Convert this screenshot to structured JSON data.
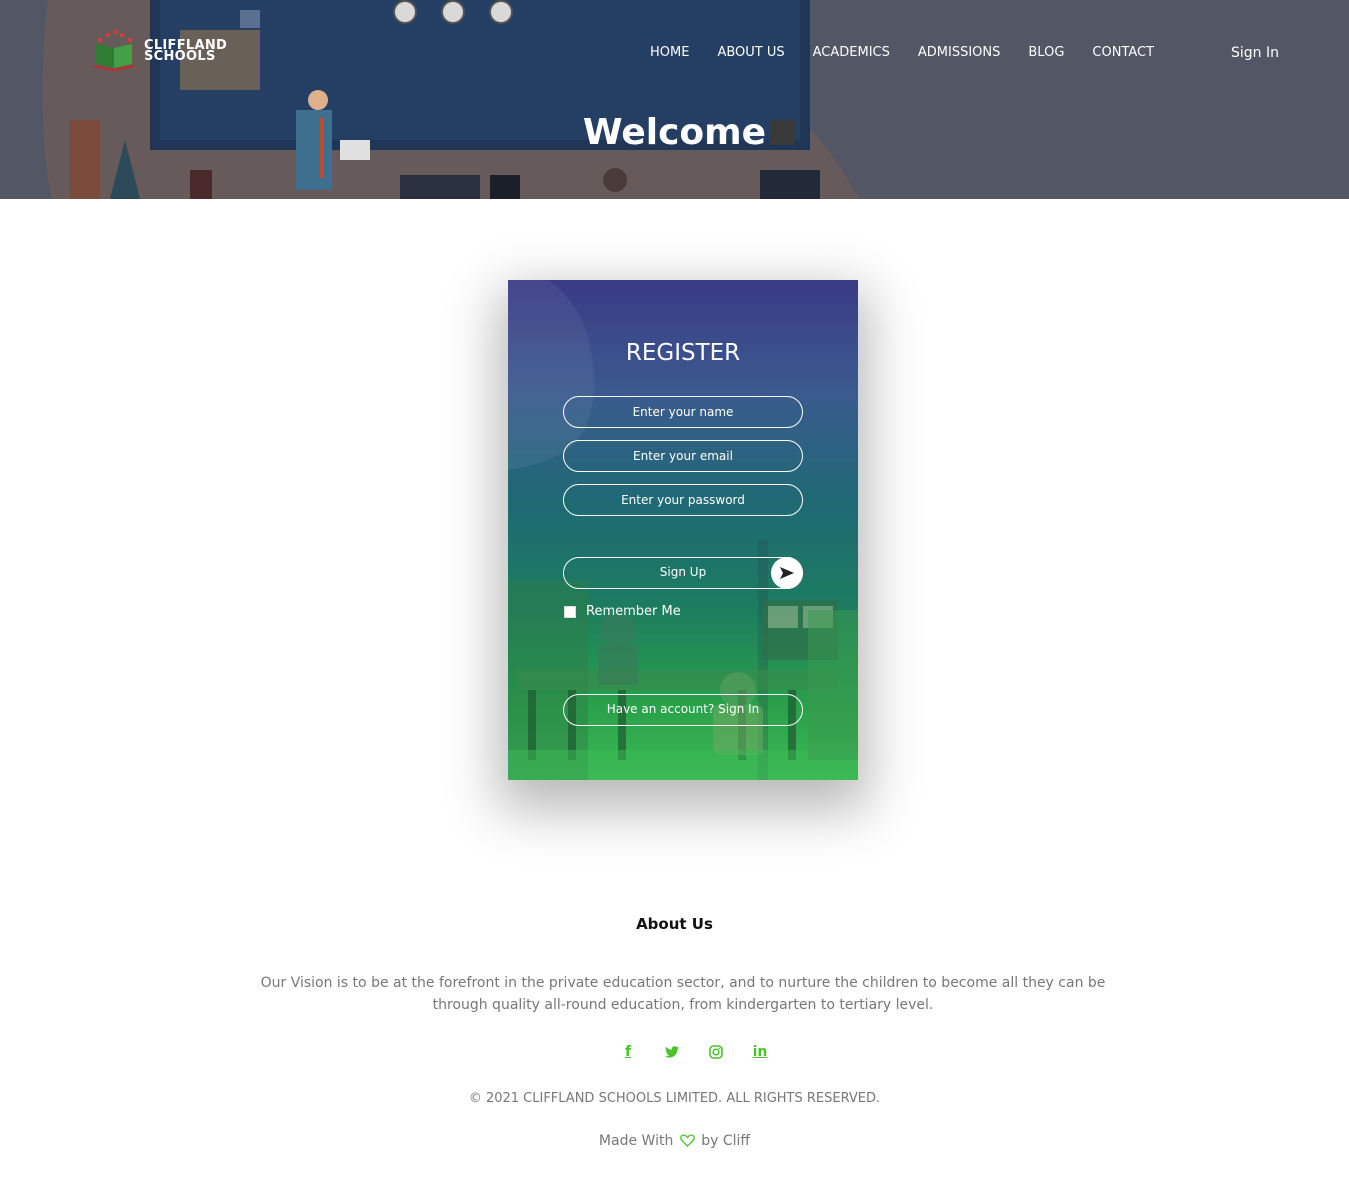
{
  "brand": {
    "line1": "CLIFFLAND",
    "line2": "SCHOOLS"
  },
  "nav": {
    "items": [
      "HOME",
      "ABOUT US",
      "ACADEMICS",
      "ADMISSIONS",
      "BLOG",
      "CONTACT"
    ],
    "signin": "Sign In"
  },
  "hero": {
    "title": "Welcome"
  },
  "register": {
    "title": "REGISTER",
    "name_placeholder": "Enter your name",
    "email_placeholder": "Enter your email",
    "password_placeholder": "Enter your password",
    "signup_label": "Sign Up",
    "remember_label": "Remember Me",
    "have_account_label": "Have an account? Sign In"
  },
  "about": {
    "title": "About Us",
    "text": "Our Vision is to be at the forefront in the private education sector, and to nurture the children to become all they can be through quality all-round education, from kindergarten to tertiary level."
  },
  "social": {
    "icons": [
      "facebook-icon",
      "twitter-icon",
      "instagram-icon",
      "linkedin-icon"
    ],
    "facebook": "f",
    "linkedin": "in"
  },
  "footer": {
    "copyright": "© 2021 CLIFFLAND SCHOOLS LIMITED. ALL RIGHTS RESERVED.",
    "made_prefix": "Made With",
    "made_suffix": "by Cliff"
  },
  "colors": {
    "hero_overlay": "#525665",
    "accent_green": "#4cc32d",
    "card_top": "#3a3a85",
    "card_bottom": "#3cba55"
  }
}
